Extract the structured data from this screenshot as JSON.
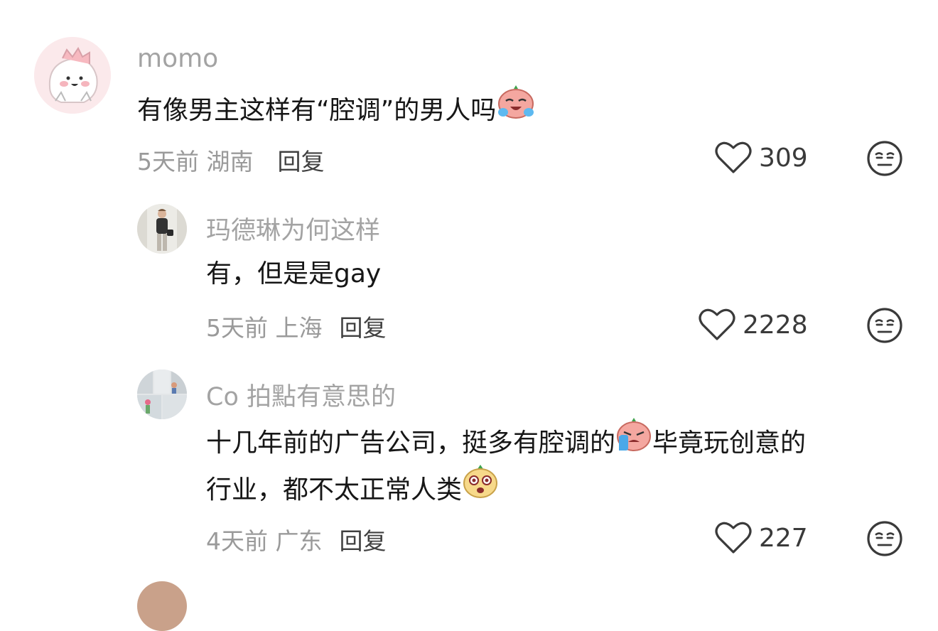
{
  "comments": [
    {
      "username": "momo",
      "text": "有像男主这样有“腔调”的男人吗",
      "time_location": "5天前 湖南",
      "reply_label": "回复",
      "likes": "309",
      "emoji": "crying-laughing-emoji"
    },
    {
      "username": "玛德琳为何这样",
      "text": "有，但是是gay",
      "time_location": "5天前 上海",
      "reply_label": "回复",
      "likes": "2228"
    },
    {
      "username": "Co 拍點有意思的",
      "text_line1": "十几年前的广告公司，挺多有腔调的",
      "text_line1_after_emoji": "毕竟玩创意的",
      "text_line2": "行业，都不太正常人类",
      "time_location": "4天前 广东",
      "reply_label": "回复",
      "likes": "227",
      "emoji1": "crying-emoji",
      "emoji2": "surprised-emoji"
    }
  ],
  "colors": {
    "username": "#a3a3a3",
    "meta": "#9a9a9a",
    "text": "#161616",
    "icon": "#3a3a3a"
  }
}
